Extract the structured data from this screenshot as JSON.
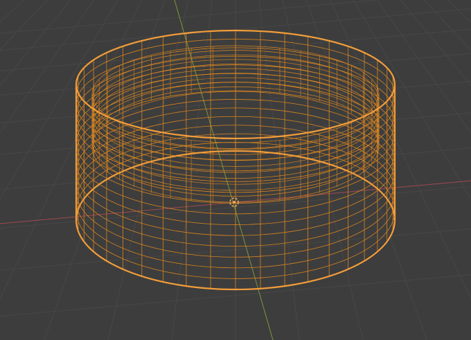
{
  "app": "3D viewport",
  "colors": {
    "background": "#3d3d3d",
    "grid": "#474747",
    "x_axis": "#a04a50",
    "y_axis": "#7a9a3a",
    "selection_outline": "#f29d3a",
    "wire": "#d9851f",
    "origin": "#f2b36a"
  },
  "viewport_objects": [
    {
      "name": "cylinder-mesh",
      "display": "wireframe",
      "selected": true
    },
    {
      "name": "object-origin",
      "icon": "origin-point-icon"
    }
  ]
}
